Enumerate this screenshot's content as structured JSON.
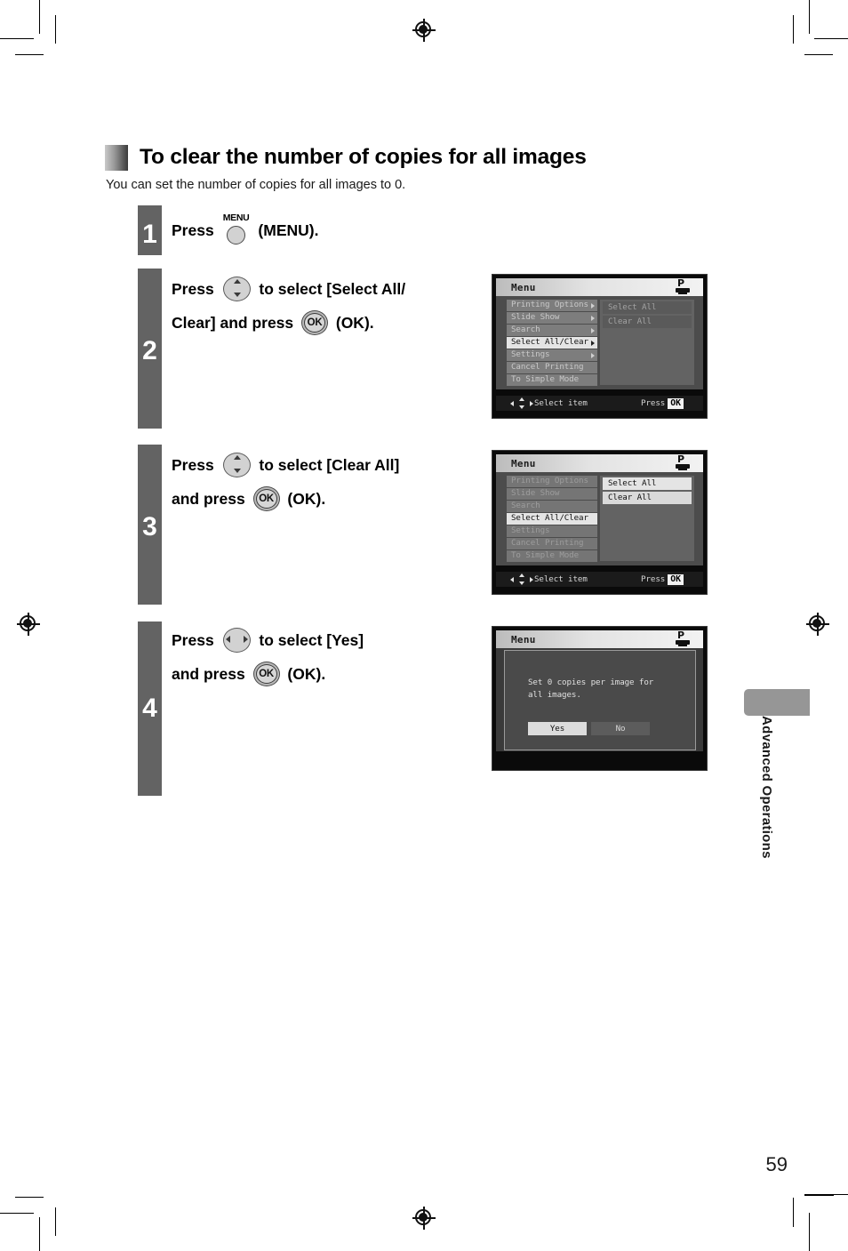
{
  "document": {
    "heading": "To clear the number of copies for all images",
    "subtitle": "You can set the number of copies for all images to 0.",
    "page_number": "59",
    "side_tab_label": "Advanced Operations"
  },
  "steps": [
    {
      "number": "1",
      "lines": [
        {
          "pre": "Press ",
          "button": "menu",
          "button_label": "MENU",
          "post": " (MENU)."
        }
      ]
    },
    {
      "number": "2",
      "lines": [
        {
          "pre": "Press ",
          "button": "updown",
          "post": " to select [Select All/"
        },
        {
          "pre": "Clear] and press ",
          "button": "ok",
          "button_label": "OK",
          "post": " (OK)."
        }
      ]
    },
    {
      "number": "3",
      "lines": [
        {
          "pre": "Press ",
          "button": "updown",
          "post": " to select [Clear All]"
        },
        {
          "pre": "and press ",
          "button": "ok",
          "button_label": "OK",
          "post": " (OK)."
        }
      ]
    },
    {
      "number": "4",
      "lines": [
        {
          "pre": "Press ",
          "button": "leftright",
          "post": " to select [Yes]"
        },
        {
          "pre": "and press ",
          "button": "ok",
          "button_label": "OK",
          "post": " (OK)."
        }
      ]
    }
  ],
  "lcd_menu_step2": {
    "title": "Menu",
    "status_icon": "printer-icon",
    "status_icon_letter": "P",
    "menu_items": [
      {
        "label": "Printing Options",
        "state": "normal",
        "arrow": true
      },
      {
        "label": "Slide Show",
        "state": "normal",
        "arrow": true
      },
      {
        "label": "Search",
        "state": "normal",
        "arrow": true
      },
      {
        "label": "Select All/Clear",
        "state": "selected",
        "arrow": true
      },
      {
        "label": "Settings",
        "state": "normal",
        "arrow": true
      },
      {
        "label": "Cancel Printing",
        "state": "normal",
        "arrow": false
      },
      {
        "label": "To Simple Mode",
        "state": "normal",
        "arrow": false
      }
    ],
    "submenu_items": [
      {
        "label": "Select All",
        "state": "dim"
      },
      {
        "label": "Clear All",
        "state": "dim"
      }
    ],
    "footer_hint": "Select item",
    "footer_press": "Press",
    "footer_ok": "OK"
  },
  "lcd_menu_step3": {
    "title": "Menu",
    "status_icon": "printer-icon",
    "status_icon_letter": "P",
    "menu_items": [
      {
        "label": "Printing Options",
        "state": "dim",
        "arrow": false
      },
      {
        "label": "Slide Show",
        "state": "dim",
        "arrow": false
      },
      {
        "label": "Search",
        "state": "dim",
        "arrow": false
      },
      {
        "label": "Select All/Clear",
        "state": "selected",
        "arrow": false
      },
      {
        "label": "Settings",
        "state": "dim",
        "arrow": false
      },
      {
        "label": "Cancel Printing",
        "state": "dim",
        "arrow": false
      },
      {
        "label": "To Simple Mode",
        "state": "dim",
        "arrow": false
      }
    ],
    "submenu_items": [
      {
        "label": "Select All",
        "state": "highlight"
      },
      {
        "label": "Clear All",
        "state": "selected"
      }
    ],
    "footer_hint": "Select item",
    "footer_press": "Press",
    "footer_ok": "OK"
  },
  "lcd_dialog_step4": {
    "title": "Menu",
    "status_icon": "printer-icon",
    "status_icon_letter": "P",
    "message_line1": "Set 0 copies per image for",
    "message_line2": "all images.",
    "buttons": [
      {
        "label": "Yes",
        "state": "selected"
      },
      {
        "label": "No",
        "state": "normal"
      }
    ]
  },
  "colors": {
    "step_bar": "#636363",
    "side_tab": "#969696",
    "lcd_background": "#0a0a0a",
    "lcd_panel": "#4c4c4c",
    "lcd_highlight": "#e4e4e4"
  }
}
